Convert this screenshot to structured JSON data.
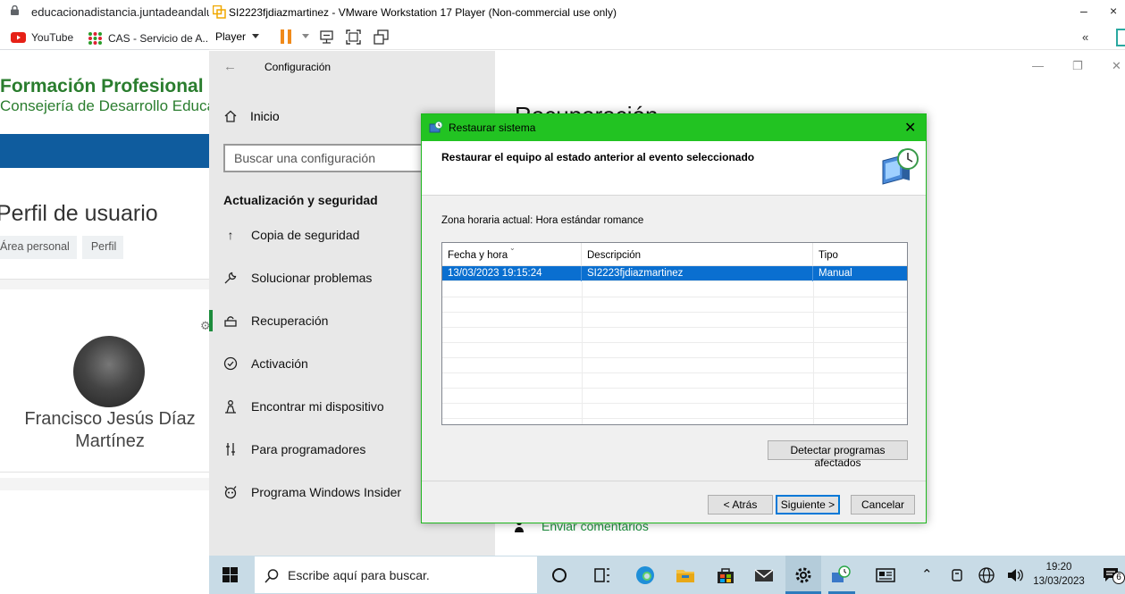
{
  "browser": {
    "url": "educacionadistancia.juntadeandalucia.es",
    "bookmarks": [
      {
        "label": "YouTube",
        "icon": "youtube-icon"
      },
      {
        "label": "CAS - Servicio de A...",
        "icon": "cas-icon"
      }
    ],
    "site": {
      "title": "Formación Profesional",
      "subtitle": "Consejería de Desarrollo Educativo",
      "profile_heading": "Perfil de usuario",
      "breadcrumbs": [
        "Área personal",
        "Perfil"
      ],
      "user_name": "Francisco Jesús Díaz Martínez"
    }
  },
  "vmware": {
    "window_title": "SI2223fjdiazmartinez - VMware Workstation 17 Player (Non-commercial use only)",
    "player_menu": "Player",
    "colors": {
      "pause": "#f08a1a"
    }
  },
  "settings": {
    "window_title": "Configuración",
    "home_label": "Inicio",
    "search_placeholder": "Buscar una configuración",
    "section_title": "Actualización y seguridad",
    "nav_items": [
      {
        "label": "Copia de seguridad",
        "icon": "arrow-up-icon"
      },
      {
        "label": "Solucionar problemas",
        "icon": "wrench-icon"
      },
      {
        "label": "Recuperación",
        "icon": "recovery-icon",
        "active": true
      },
      {
        "label": "Activación",
        "icon": "check-circle-icon"
      },
      {
        "label": "Encontrar mi dispositivo",
        "icon": "person-locate-icon"
      },
      {
        "label": "Para programadores",
        "icon": "developer-icon"
      },
      {
        "label": "Programa Windows Insider",
        "icon": "insider-icon"
      }
    ],
    "page_title": "Recuperación",
    "feedback_link": "Enviar comentarios",
    "accent": "#1c8c3c"
  },
  "dialog": {
    "title": "Restaurar sistema",
    "heading": "Restaurar el equipo al estado anterior al evento seleccionado",
    "timezone": "Zona horaria actual: Hora estándar romance",
    "columns": [
      "Fecha y hora",
      "Descripción",
      "Tipo"
    ],
    "rows": [
      {
        "date": "13/03/2023 19:15:24",
        "description": "SI2223fjdiazmartinez",
        "type": "Manual",
        "selected": true
      }
    ],
    "detect_button": "Detectar programas afectados",
    "back_button": "< Atrás",
    "next_button": "Siguiente >",
    "cancel_button": "Cancelar",
    "title_color": "#22c322",
    "selection_color": "#0a6fd0"
  },
  "taskbar": {
    "search_placeholder": "Escribe aquí para buscar.",
    "time": "19:20",
    "date": "13/03/2023",
    "notification_count": "6"
  }
}
